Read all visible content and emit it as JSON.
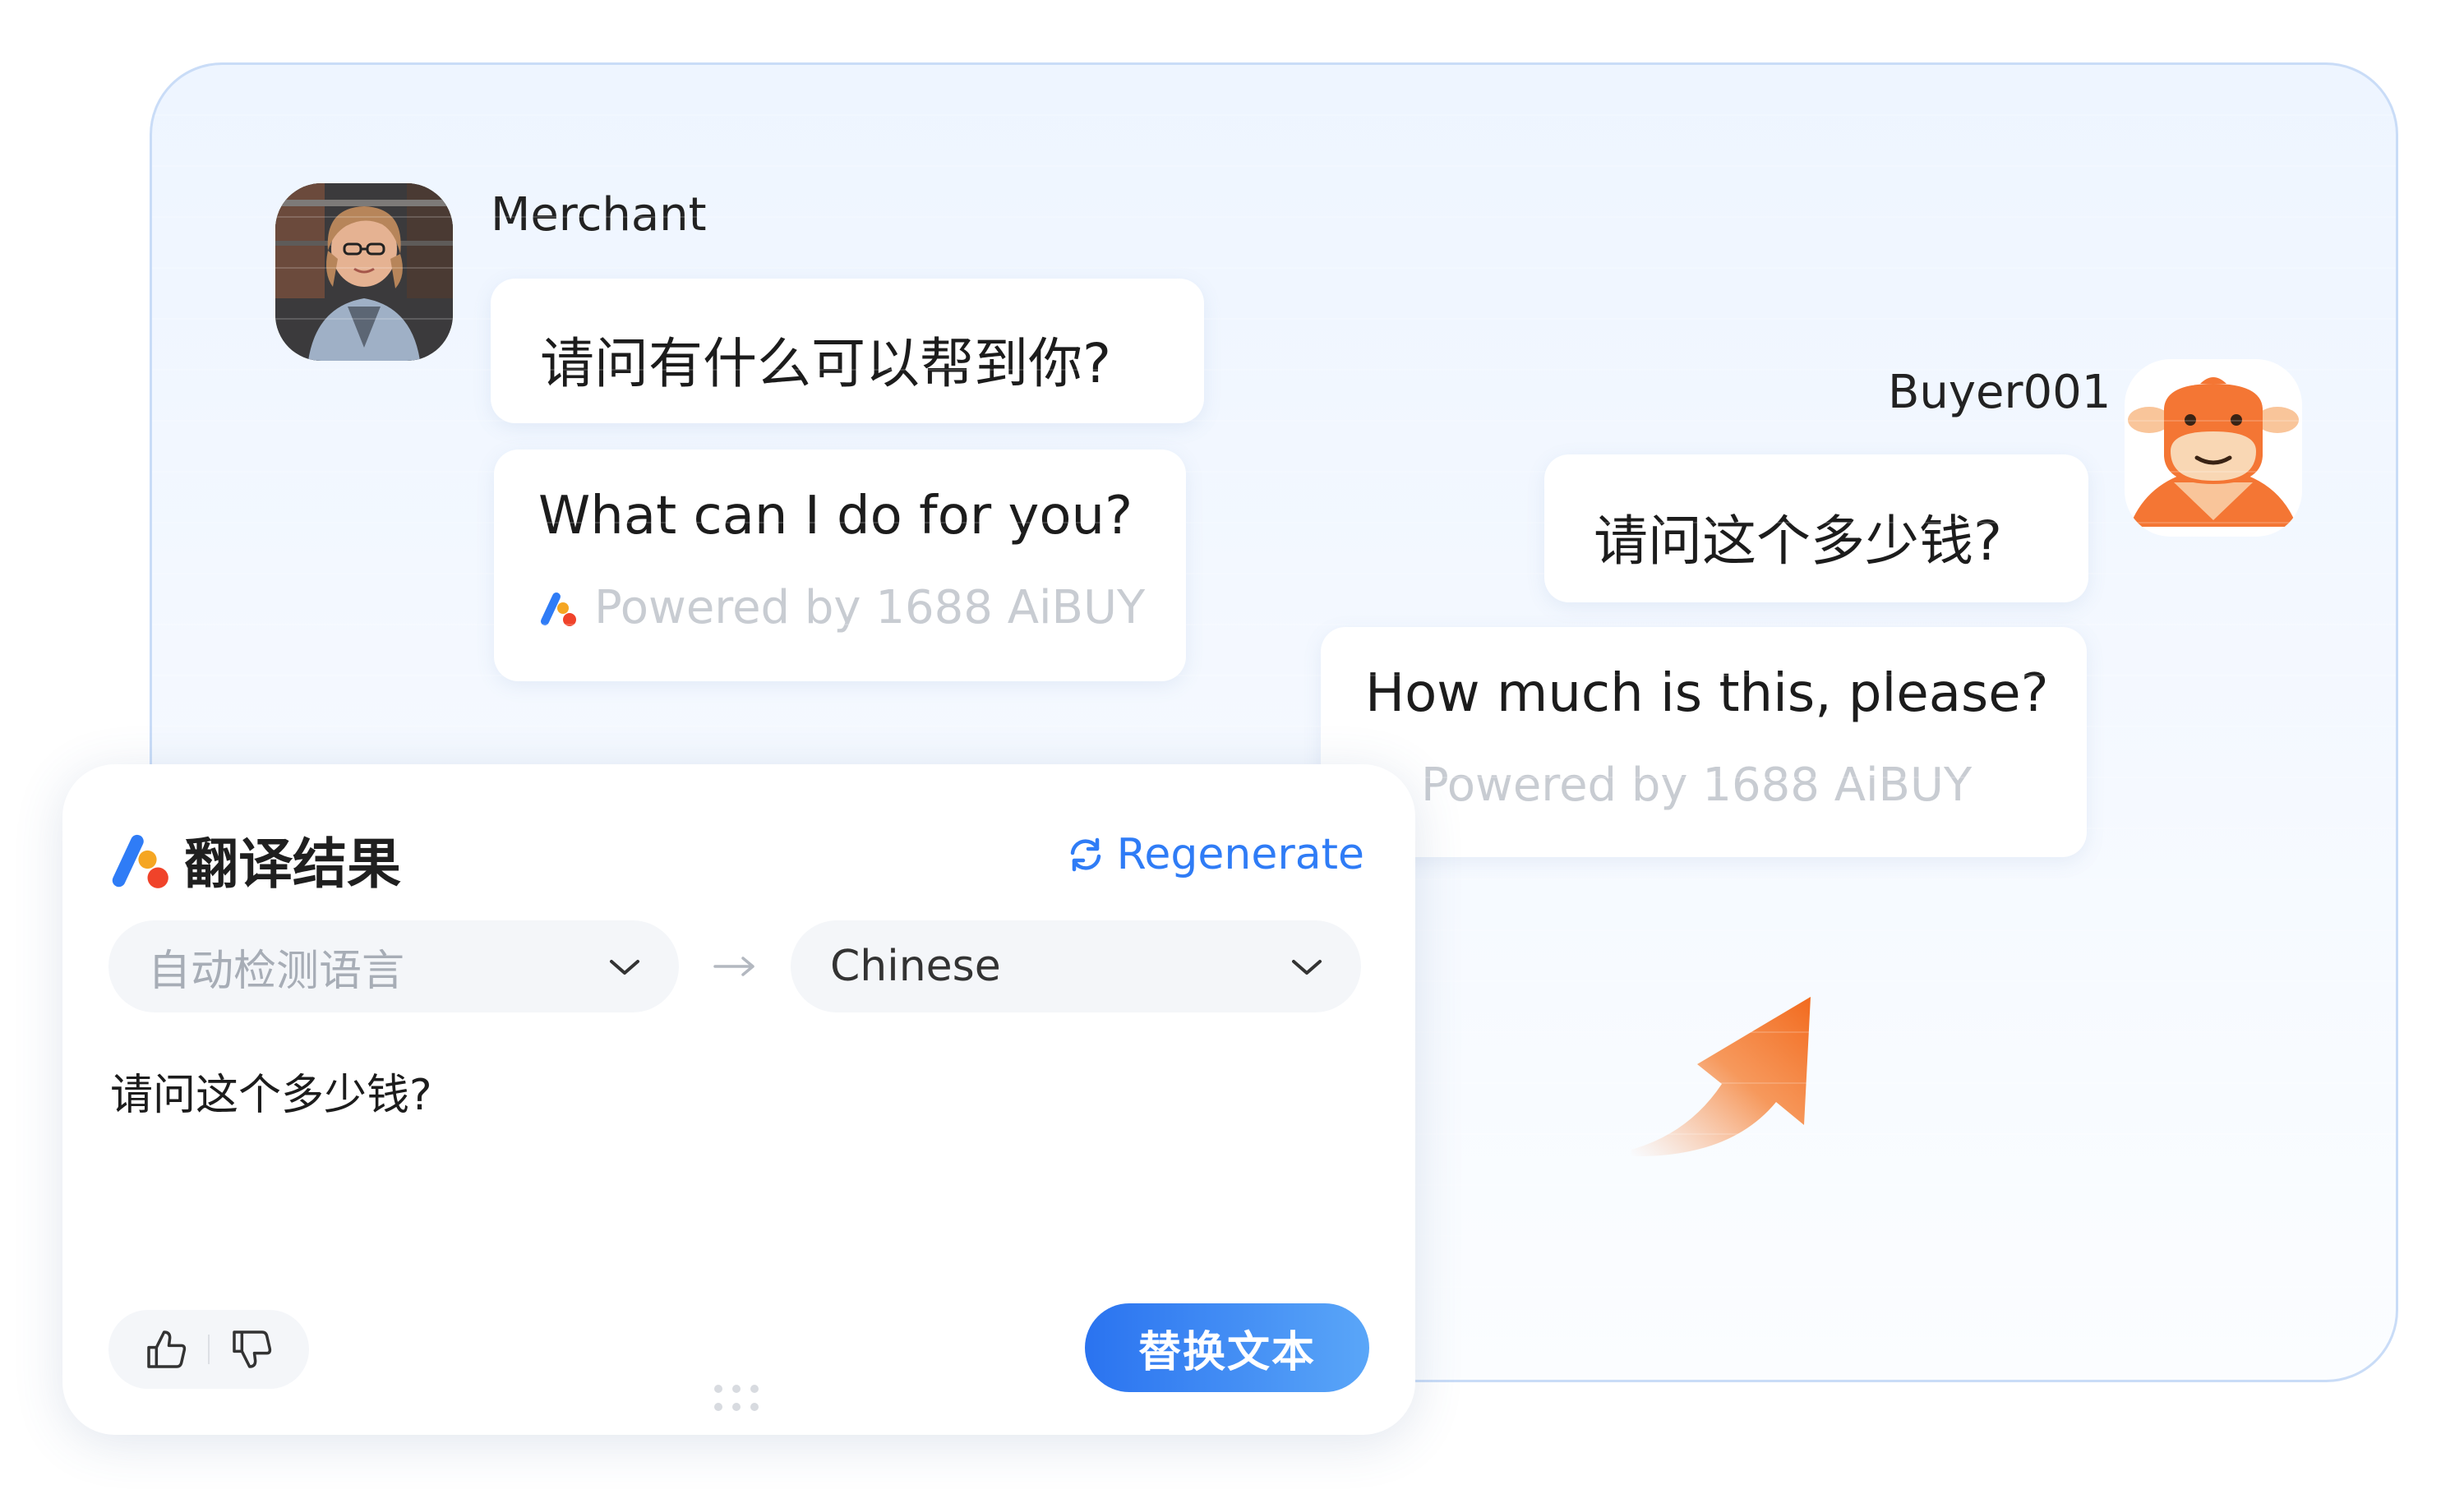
{
  "conversation": {
    "merchant": {
      "name": "Merchant",
      "message_original": "请问有什么可以帮到你?",
      "message_translated": "What can I do for you?",
      "powered_by": "Powered by 1688 AiBUY"
    },
    "buyer": {
      "name": "Buyer001",
      "message_original": "请问这个多少钱?",
      "message_translated": "How much is this, please?",
      "powered_by": "Powered by 1688 AiBUY"
    }
  },
  "translation_panel": {
    "title": "翻译结果",
    "regenerate_label": "Regenerate",
    "source_language": "自动检测语言",
    "target_language": "Chinese",
    "source_text": "请问这个多少钱?",
    "replace_label": "替换文本"
  },
  "colors": {
    "accent_blue": "#2f7cf6",
    "brand_orange": "#f26a2e",
    "muted_text": "#c8ccd2"
  },
  "icons": {
    "brand": "aibuy-logo-icon",
    "regenerate": "refresh-icon",
    "dropdown": "chevron-down-icon",
    "direction": "arrow-right-icon",
    "like": "thumbs-up-icon",
    "dislike": "thumbs-down-icon",
    "drag": "drag-handle-icon"
  }
}
